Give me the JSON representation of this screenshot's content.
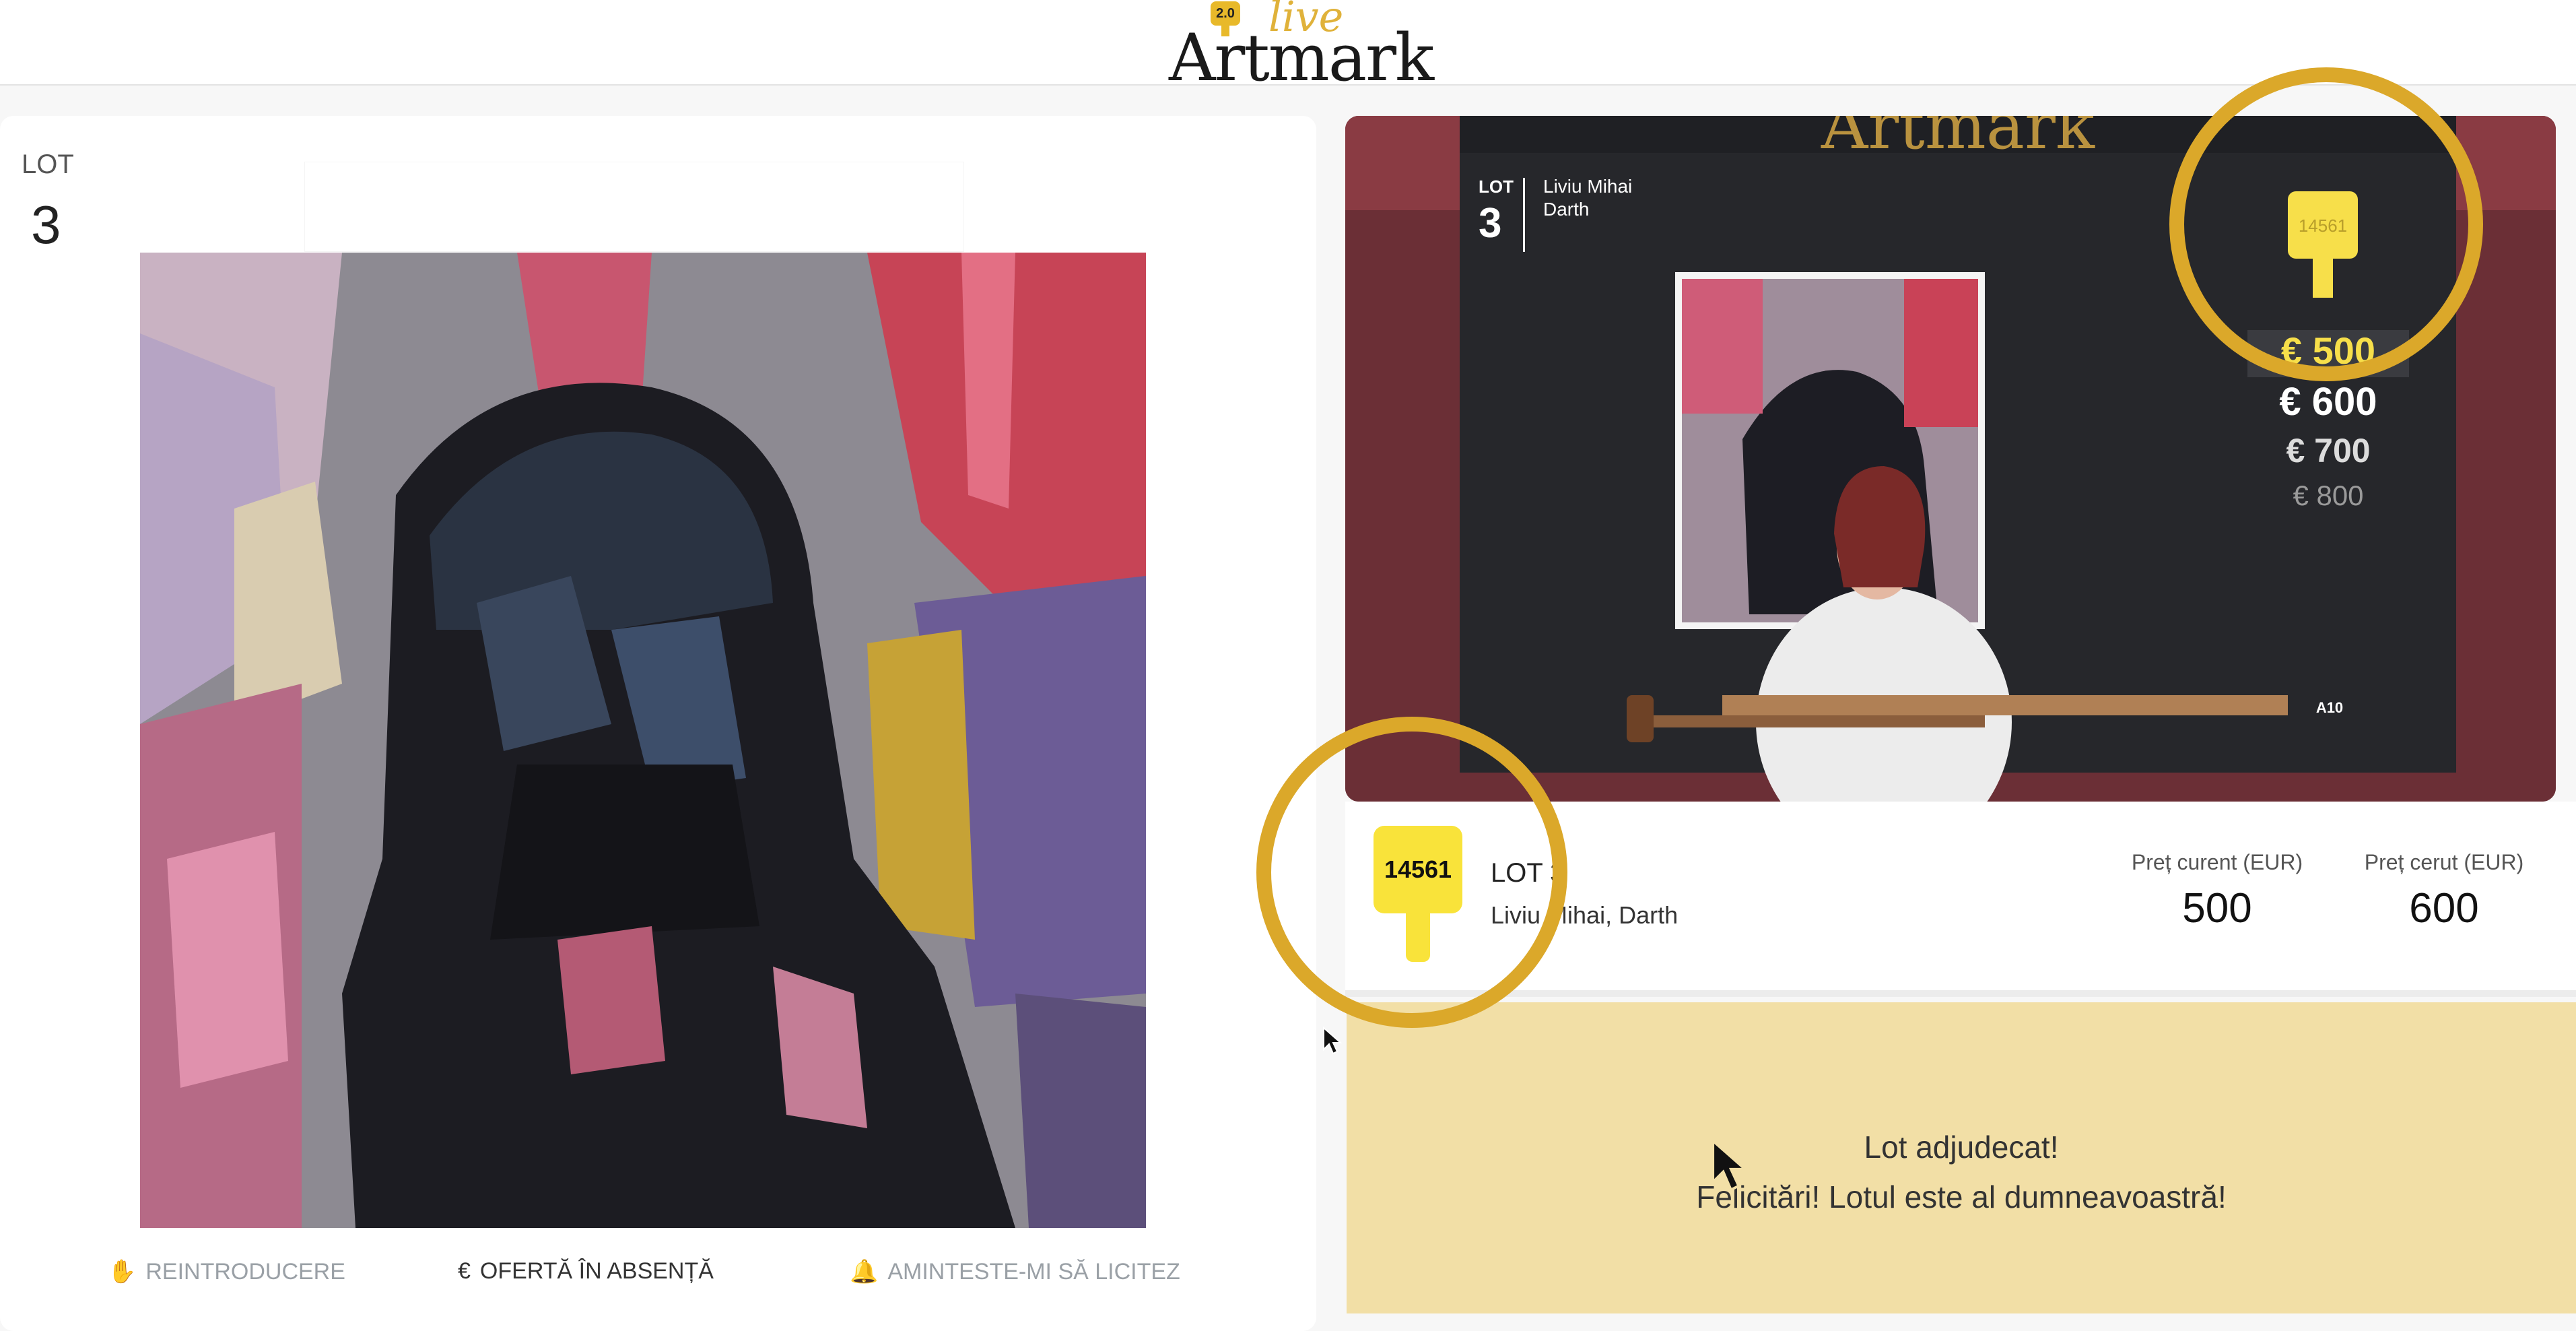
{
  "header": {
    "logo_main": "Artmark",
    "logo_live": "live",
    "logo_badge": "2.0"
  },
  "left": {
    "lot_label": "LOT",
    "lot_number": "3",
    "actions": [
      {
        "label": "REINTRODUCERE",
        "icon": "hand-icon",
        "enabled": false
      },
      {
        "label": "OFERTĂ ÎN ABSENȚĂ",
        "icon": "euro-icon",
        "enabled": true
      },
      {
        "label": "AMINTESTE-MI SĂ LICITEZ",
        "icon": "bell-icon",
        "enabled": false
      }
    ]
  },
  "video": {
    "screen_brand": "Artmark",
    "screen_lot_label": "LOT",
    "screen_lot_number": "3",
    "screen_artist_line1": "Liviu Mihai",
    "screen_artist_line2": "Darth",
    "screen_paddle_number": "14561",
    "bids": [
      "€ 500",
      "€ 600",
      "€ 700",
      "€ 800"
    ],
    "screen_code": "A10"
  },
  "info": {
    "paddle_number": "14561",
    "lot_text": "LOT 3",
    "artist_title": "Liviu Mihai, Darth",
    "current_price_label": "Preț curent (EUR)",
    "current_price_value": "500",
    "asked_price_label": "Preț cerut (EUR)",
    "asked_price_value": "600"
  },
  "sold": {
    "title": "Lot adjudecat!",
    "subtitle": "Felicitări! Lotul este al dumneavoastră!"
  },
  "colors": {
    "highlight": "#dba82a",
    "paddle_yellow": "#f9e33a",
    "sold_bg": "#f2dfa6",
    "brand_gold": "#e0b23a"
  }
}
